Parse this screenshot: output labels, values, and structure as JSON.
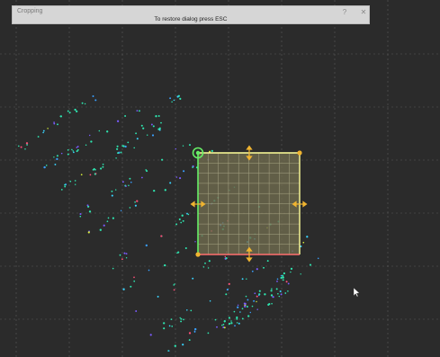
{
  "dialog": {
    "title": "Cropping",
    "hint": "To restore dialog press ESC",
    "help_label": "?",
    "close_label": "✕"
  },
  "colors": {
    "background": "#2b2b2b",
    "grid_line": "#5a5a5a",
    "selection_fill": "#6e6a4e",
    "selection_outline": "#ffff99",
    "edge_left": "#66ee66",
    "edge_bottom": "#ff6f6f",
    "handle": "#f0b430",
    "rotate_handle": "#66ee66",
    "points": [
      "#2ee6b0",
      "#3aa0ff",
      "#7b5cff",
      "#39d4ff",
      "#ff4f7a",
      "#d8f03a"
    ]
  },
  "icons": {
    "rotate_handle": "rotate-handle-icon",
    "cursor": "mouse-cursor-icon"
  }
}
